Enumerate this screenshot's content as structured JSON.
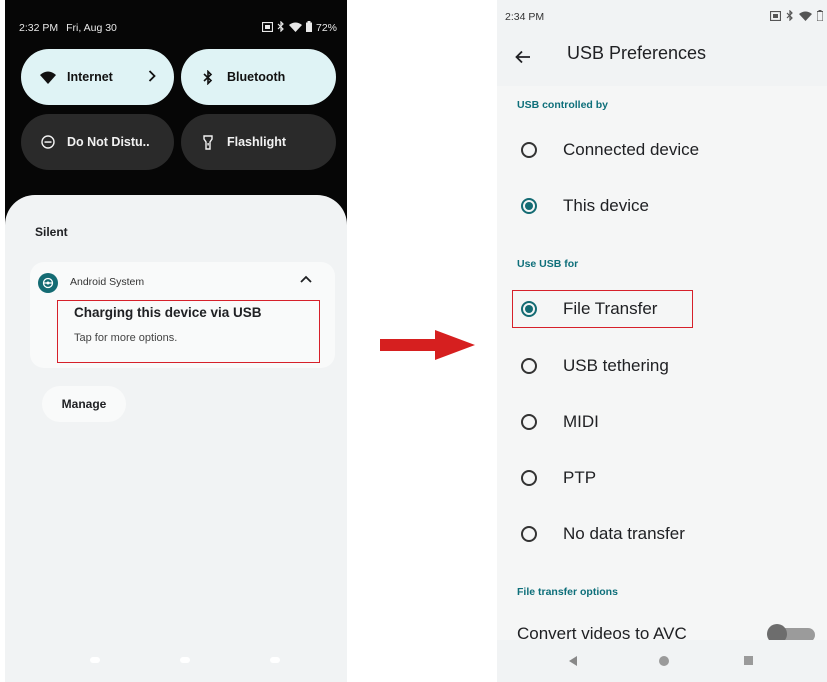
{
  "left_screen": {
    "status_bar": {
      "time": "2:32 PM",
      "date": "Fri, Aug 30",
      "battery": "72%"
    },
    "quick_tiles": [
      {
        "label": "Internet",
        "icon": "wifi-icon"
      },
      {
        "label": "Bluetooth",
        "icon": "bluetooth-icon"
      },
      {
        "label": "Do Not Distu..",
        "icon": "do-not-disturb-icon"
      },
      {
        "label": "Flashlight",
        "icon": "flashlight-icon"
      }
    ],
    "section_label": "Silent",
    "notification": {
      "app_name": "Android System",
      "title": "Charging this device via USB",
      "text": "Tap for more options."
    },
    "manage_label": "Manage"
  },
  "right_screen": {
    "status_bar": {
      "time": "2:34 PM"
    },
    "title": "USB Preferences",
    "section_controlled_by": "USB controlled by",
    "controlled_by_options": [
      {
        "label": "Connected device",
        "selected": false
      },
      {
        "label": "This device",
        "selected": true
      }
    ],
    "section_use_for": "Use USB for",
    "use_for_options": [
      {
        "label": "File Transfer",
        "selected": true
      },
      {
        "label": "USB tethering",
        "selected": false
      },
      {
        "label": "MIDI",
        "selected": false
      },
      {
        "label": "PTP",
        "selected": false
      },
      {
        "label": "No data transfer",
        "selected": false
      }
    ],
    "section_file_transfer": "File transfer options",
    "convert_label": "Convert videos to AVC",
    "convert_enabled": false
  },
  "colors": {
    "accent": "#146b73",
    "highlight": "#d6202a",
    "arrow": "#d61f1f"
  }
}
